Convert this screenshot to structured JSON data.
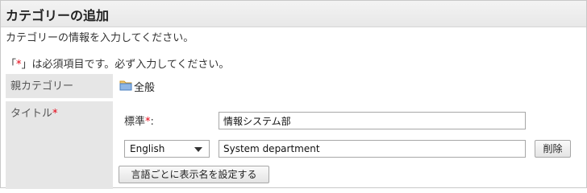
{
  "page": {
    "title": "カテゴリーの追加",
    "subtitle": "カテゴリーの情報を入力してください。"
  },
  "required_note": {
    "prefix": "「",
    "mark": "*",
    "suffix": "」は必須項目です。必ず入力してください。"
  },
  "fields": {
    "parent": {
      "label": "親カテゴリー",
      "value": "全般",
      "icon": "folder-icon"
    },
    "title": {
      "label": "タイトル",
      "required_mark": "*",
      "standard_label": "標準",
      "standard_suffix": ":",
      "standard_value": "情報システム部",
      "language": "English",
      "language_value": "System department",
      "delete_label": "削除",
      "set_names_label": "言語ごとに表示名を設定する"
    }
  },
  "colors": {
    "required": "#e60012",
    "label_bg": "#e6e6e6",
    "header_bg": "#efefef"
  }
}
